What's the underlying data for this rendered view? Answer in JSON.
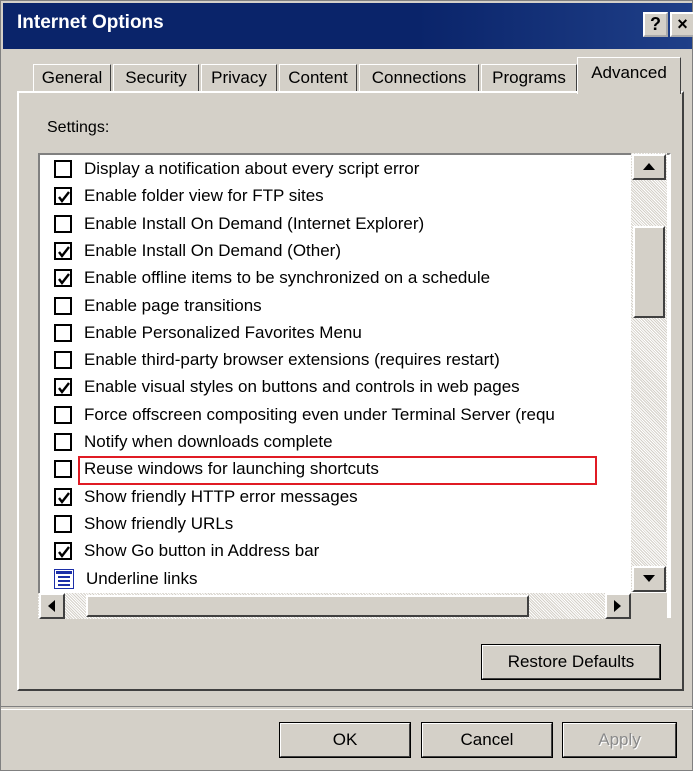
{
  "window": {
    "title": "Internet Options",
    "help_label": "?",
    "close_label": "×"
  },
  "tabs": [
    {
      "label": "General"
    },
    {
      "label": "Security"
    },
    {
      "label": "Privacy"
    },
    {
      "label": "Content"
    },
    {
      "label": "Connections"
    },
    {
      "label": "Programs"
    },
    {
      "label": "Advanced",
      "selected": true
    }
  ],
  "settings": {
    "label": "Settings:",
    "items": [
      {
        "label": "Display a notification about every script error",
        "checked": false
      },
      {
        "label": "Enable folder view for FTP sites",
        "checked": true
      },
      {
        "label": "Enable Install On Demand (Internet Explorer)",
        "checked": false
      },
      {
        "label": "Enable Install On Demand (Other)",
        "checked": true
      },
      {
        "label": "Enable offline items to be synchronized on a schedule",
        "checked": true
      },
      {
        "label": "Enable page transitions",
        "checked": false
      },
      {
        "label": "Enable Personalized Favorites Menu",
        "checked": false
      },
      {
        "label": "Enable third-party browser extensions (requires restart)",
        "checked": false
      },
      {
        "label": "Enable visual styles on buttons and controls in web pages",
        "checked": true
      },
      {
        "label": "Force offscreen compositing even under Terminal Server (requ",
        "checked": false
      },
      {
        "label": "Notify when downloads complete",
        "checked": false
      },
      {
        "label": "Reuse windows for launching shortcuts",
        "checked": false,
        "highlighted": true
      },
      {
        "label": "Show friendly HTTP error messages",
        "checked": true
      },
      {
        "label": "Show friendly URLs",
        "checked": false
      },
      {
        "label": "Show Go button in Address bar",
        "checked": true
      },
      {
        "label": "Underline links",
        "icon": "category-icon"
      }
    ]
  },
  "buttons": {
    "restore_defaults": "Restore Defaults",
    "ok": "OK",
    "cancel": "Cancel",
    "apply": "Apply"
  },
  "colors": {
    "title_bar": "#0a246a",
    "dialog_face": "#d4d0c8",
    "highlight_box": "#e01b24"
  }
}
